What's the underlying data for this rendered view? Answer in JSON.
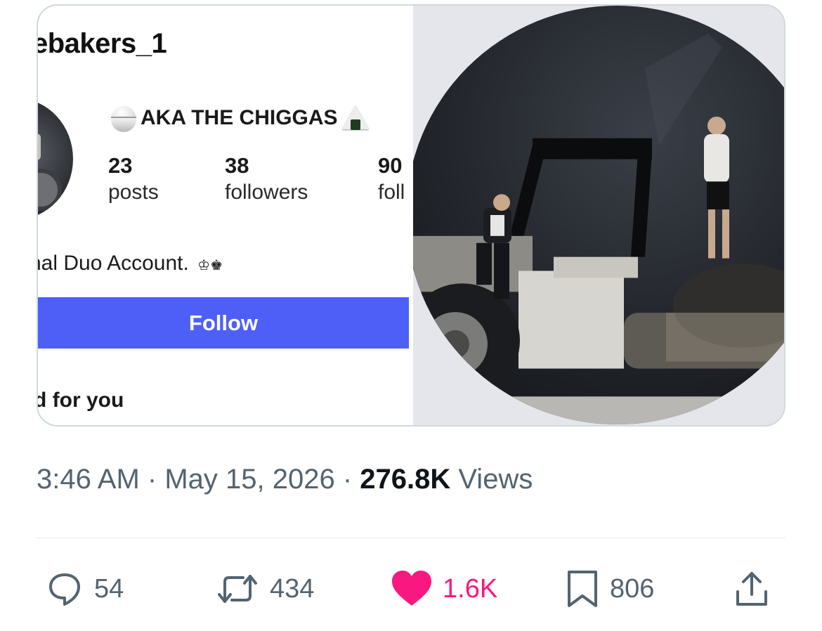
{
  "profile_card": {
    "username": "ebakers_1",
    "display_name": "AKA THE CHIGGAS",
    "display_name_icons": [
      "rice-bowl-icon",
      "onigiri-icon"
    ],
    "stats": [
      {
        "value": "23",
        "label": "posts"
      },
      {
        "value": "38",
        "label": "followers"
      },
      {
        "value": "90",
        "label": "foll"
      }
    ],
    "bio": "nal Duo Account.",
    "bio_symbols": "♔♚",
    "follow_label": "Follow",
    "follow_color": "#4e5ff8",
    "suggested_label": "d for you"
  },
  "tweet_meta": {
    "time": "3:46 AM",
    "separator": " · ",
    "date": "May 15, 2026",
    "views_count": "276.8K",
    "views_label": " Views"
  },
  "actions": {
    "reply": {
      "count": "54",
      "icon": "reply-icon"
    },
    "repost": {
      "count": "434",
      "icon": "repost-icon"
    },
    "like": {
      "count": "1.6K",
      "icon": "heart-icon",
      "color": "#f91880"
    },
    "bookmark": {
      "count": "806",
      "icon": "bookmark-icon"
    },
    "share": {
      "icon": "share-icon"
    }
  }
}
